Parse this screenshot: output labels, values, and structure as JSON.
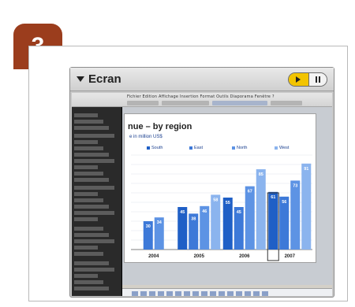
{
  "step": {
    "number": "3"
  },
  "screen": {
    "title": "Ecran"
  },
  "app": {
    "menu": "Fichier  Edition  Affichage  Insertion  Format  Outils  Diaporama  Fenêtre  ?"
  },
  "chart_data": {
    "type": "bar",
    "title": "nue – by region",
    "subtitle": "e in million US$",
    "categories": [
      "2004",
      "2005",
      "2006",
      "2007"
    ],
    "series": [
      {
        "name": "South",
        "color": "#1f5fc6",
        "values": [
          null,
          45,
          55,
          61
        ]
      },
      {
        "name": "East",
        "color": "#3d79d8",
        "values": [
          30,
          38,
          45,
          56
        ]
      },
      {
        "name": "North",
        "color": "#5d93e4",
        "values": [
          34,
          46,
          67,
          73
        ]
      },
      {
        "name": "West",
        "color": "#8bb4ee",
        "values": [
          null,
          58,
          85,
          91
        ]
      }
    ],
    "ylim": [
      0,
      100
    ],
    "grid": true,
    "legend_position": "top",
    "highlighted_category": "2007"
  }
}
